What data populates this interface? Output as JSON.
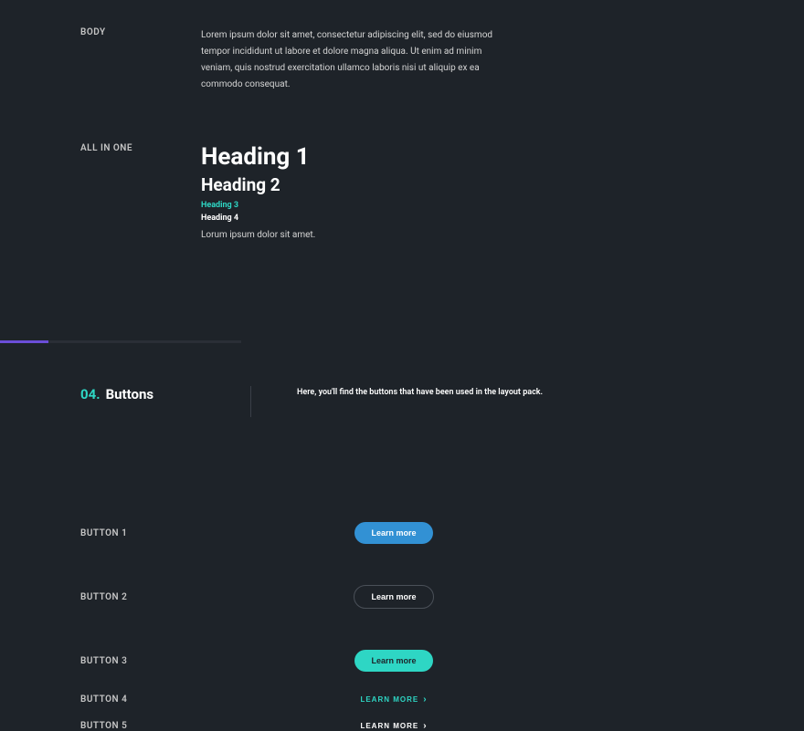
{
  "typography": {
    "body": {
      "label": "BODY",
      "text": "Lorem ipsum dolor sit amet, consectetur adipiscing elit, sed do eiusmod tempor incididunt ut labore et dolore magna aliqua. Ut enim ad minim veniam, quis nostrud exercitation ullamco laboris nisi ut aliquip ex ea commodo consequat."
    },
    "allinone": {
      "label": "ALL IN ONE",
      "heading1": "Heading 1",
      "heading2": "Heading 2",
      "heading3": "Heading 3",
      "heading4": "Heading 4",
      "paragraph": "Lorum ipsum dolor sit amet."
    }
  },
  "buttons_section": {
    "number": "04.",
    "title": "Buttons",
    "description": "Here, you'll find the buttons that have been used in the layout pack."
  },
  "buttons": {
    "btn1": {
      "label": "BUTTON 1",
      "text": "Learn more"
    },
    "btn2": {
      "label": "BUTTON 2",
      "text": "Learn more"
    },
    "btn3": {
      "label": "BUTTON 3",
      "text": "Learn more"
    },
    "btn4": {
      "label": "BUTTON 4",
      "text": "LEARN MORE"
    },
    "btn5": {
      "label": "BUTTON 5",
      "text": "LEARN MORE"
    }
  }
}
